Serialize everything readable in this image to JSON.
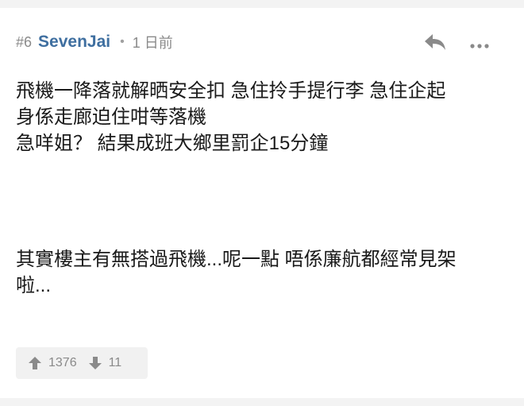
{
  "post": {
    "floor": "#6",
    "username": "SevenJai",
    "separator": "•",
    "time": "1 日前",
    "content_lines": [
      "飛機一降落就解晒安全扣 急住拎手提行李 急住企起",
      "身係走廊迫住咁等落機",
      "急咩姐？ 結果成班大鄉里罰企15分鐘"
    ],
    "content_lines_2": [
      "其實樓主有無搭過飛機...呢一點 唔係廉航都經常見架",
      "啦..."
    ],
    "votes": {
      "up_count": "1376",
      "down_count": "11"
    }
  },
  "icons": {
    "reply": "reply-arrow-icon",
    "more": "more-dots-icon",
    "upvote": "arrow-up-icon",
    "downvote": "arrow-down-icon"
  },
  "colors": {
    "username": "#3f6fa0",
    "meta": "#8a8a8a",
    "text": "#1a1a1a",
    "icon": "#8a8a8a"
  }
}
